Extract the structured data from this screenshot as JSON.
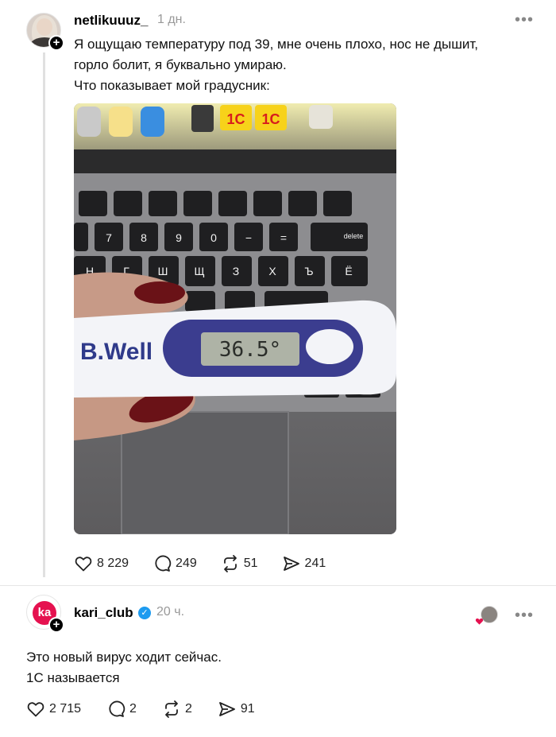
{
  "post1": {
    "username": "netlikuuuz_",
    "time": "1 дн.",
    "text_lines": [
      "Я ощущаю температуру под 39, мне очень плохо, нос не дышит,",
      "горло болит, я буквально умираю.",
      "Что показывает мой градусник:"
    ],
    "photo": {
      "brand": "B.Well",
      "reading": "36.5°",
      "keys_top": [
        "1C",
        "1C"
      ],
      "key_delete": "delete"
    },
    "likes": "8 229",
    "comments": "249",
    "reposts": "51",
    "shares": "241"
  },
  "post2": {
    "username": "kari_club",
    "logo_text": "ka",
    "time": "20 ч.",
    "text_lines": [
      "Это новый вирус ходит сейчас.",
      "1С называется"
    ],
    "likes": "2 715",
    "comments": "2",
    "reposts": "2",
    "shares": "91"
  },
  "icons": {
    "more": "more-horizontal-icon",
    "like": "heart-icon",
    "comment": "comment-icon",
    "repost": "repost-icon",
    "share": "send-icon",
    "follow": "plus-icon",
    "verified": "verified-check-icon"
  },
  "colors": {
    "brand_red": "#e5114f",
    "verified_blue": "#1d9bf0",
    "muted": "#999999"
  }
}
